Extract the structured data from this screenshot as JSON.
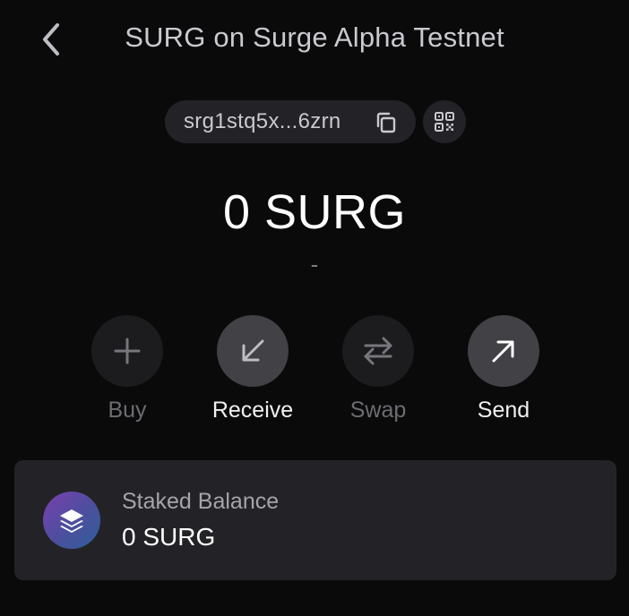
{
  "header": {
    "title": "SURG on Surge Alpha Testnet"
  },
  "address": {
    "short": "srg1stq5x...6zrn"
  },
  "balance": {
    "amount": "0 SURG",
    "fiat": "-"
  },
  "actions": [
    {
      "label": "Buy",
      "icon": "plus-icon",
      "enabled": false
    },
    {
      "label": "Receive",
      "icon": "arrow-down-left-icon",
      "enabled": true
    },
    {
      "label": "Swap",
      "icon": "swap-arrows-icon",
      "enabled": false
    },
    {
      "label": "Send",
      "icon": "arrow-up-right-icon",
      "enabled": true
    }
  ],
  "staked": {
    "label": "Staked Balance",
    "value": "0 SURG",
    "icon": "layers-icon"
  },
  "colors": {
    "background": "#0a0a0b",
    "surface": "#232327",
    "enabled_button": "#414146",
    "disabled_button": "#1c1c1f",
    "stake_gradient_start": "#7b3fb0",
    "stake_gradient_end": "#2f5f9a"
  }
}
